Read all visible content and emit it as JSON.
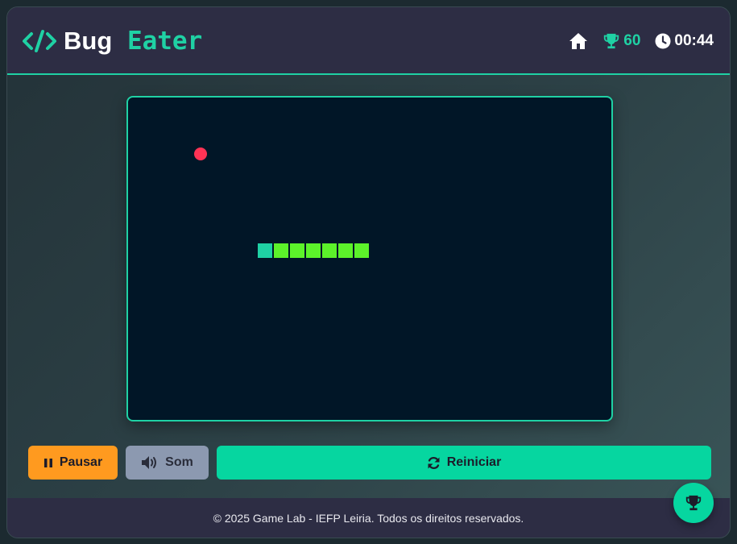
{
  "header": {
    "title_part1": "Bug",
    "title_part2": "Eater",
    "score": "60",
    "timer": "00:44"
  },
  "icons": {
    "logo": "code-brackets-icon",
    "home": "home-icon",
    "trophy": "trophy-icon",
    "clock": "clock-icon",
    "pause": "pause-icon",
    "sound": "volume-icon",
    "restart": "refresh-icon"
  },
  "game": {
    "grid": {
      "cols": 30,
      "rows": 20
    },
    "snake": [
      [
        8,
        9
      ],
      [
        9,
        9
      ],
      [
        10,
        9
      ],
      [
        11,
        9
      ],
      [
        12,
        9
      ],
      [
        13,
        9
      ],
      [
        14,
        9
      ]
    ],
    "food": [
      4,
      3
    ]
  },
  "controls": {
    "pause_label": "Pausar",
    "sound_label": "Som",
    "restart_label": "Reiniciar"
  },
  "footer": {
    "copyright": "©  2025  Game Lab - IEFP Leiria. Todos os direitos reservados."
  },
  "colors": {
    "accent": "#1fd1a4",
    "board_bg": "#011627",
    "snake_head": "#1fd1a4",
    "snake_body": "#5cf22a",
    "food": "#ff3355",
    "pause_btn": "#ff9a1f",
    "sound_btn": "#8c99b0",
    "restart_btn": "#06d6a0"
  }
}
